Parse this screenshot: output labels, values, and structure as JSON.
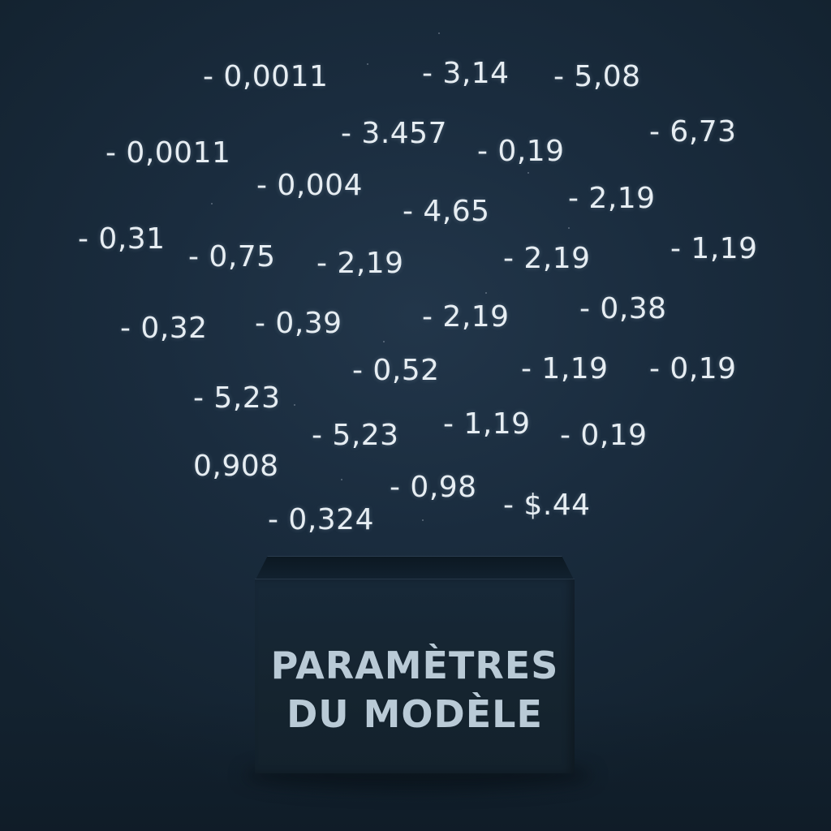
{
  "numbers": [
    "- 0,0011",
    "- 3,14",
    "- 5,08",
    "- 0,0011",
    "- 3.457",
    "- 0,19",
    "- 6,73",
    "- 0,004",
    "- 4,65",
    "- 2,19",
    "- 0,31",
    "- 0,75",
    "- 2,19",
    "- 2,19",
    "- 1,19",
    "- 0,32",
    "- 0,39",
    "- 2,19",
    "- 0,38",
    "- 0,52",
    "- 1,19",
    "- 0,19",
    "- 5,23",
    "- 5,23",
    "- 1,19",
    "- 0,19",
    "0,908",
    "- 0,98",
    "- $.44",
    "- 0,324"
  ],
  "box": {
    "line1": "PARAMÈTRES",
    "line2": "DU MODÈLE"
  },
  "colors": {
    "background": "#1a2c3e",
    "text": "#e6edf2",
    "box": "#15242f",
    "box_text": "#b9cad6"
  }
}
